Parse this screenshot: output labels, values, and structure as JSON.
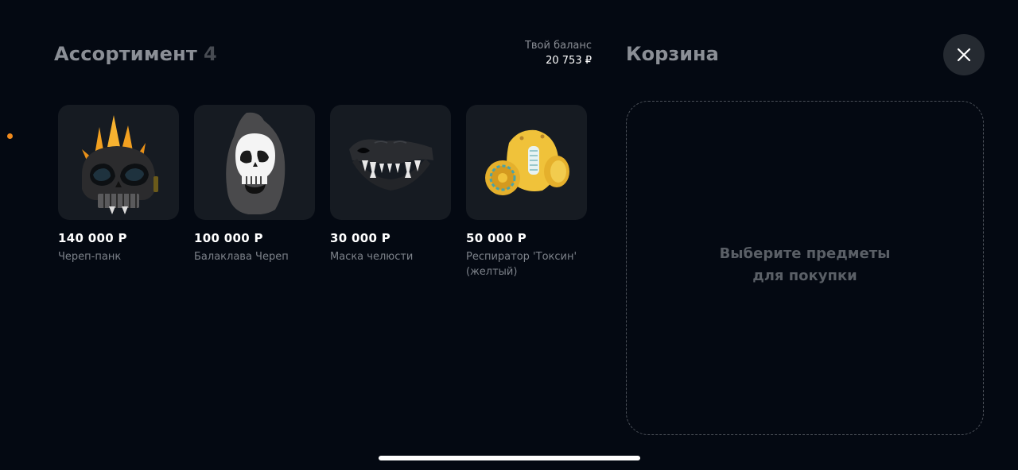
{
  "assortment": {
    "title": "Ассортимент",
    "count": "4"
  },
  "balance": {
    "label": "Твой баланс",
    "value": "20 753 ₽"
  },
  "items": [
    {
      "price": "140 000 Р",
      "name": "Череп-панк",
      "icon": "skull-punk-helmet-icon"
    },
    {
      "price": "100 000 Р",
      "name": "Балаклава Череп",
      "icon": "skull-balaclava-icon"
    },
    {
      "price": "30 000 Р",
      "name": "Маска челюсти",
      "icon": "jaw-mask-icon"
    },
    {
      "price": "50 000 Р",
      "name": "Респиратор 'Токсин' (желтый)",
      "icon": "yellow-respirator-icon"
    }
  ],
  "cart": {
    "title": "Корзина",
    "empty_text": "Выберите предметы для покупки"
  },
  "colors": {
    "accent": "#f08a1c",
    "background": "#040912",
    "card": "#161b22"
  }
}
